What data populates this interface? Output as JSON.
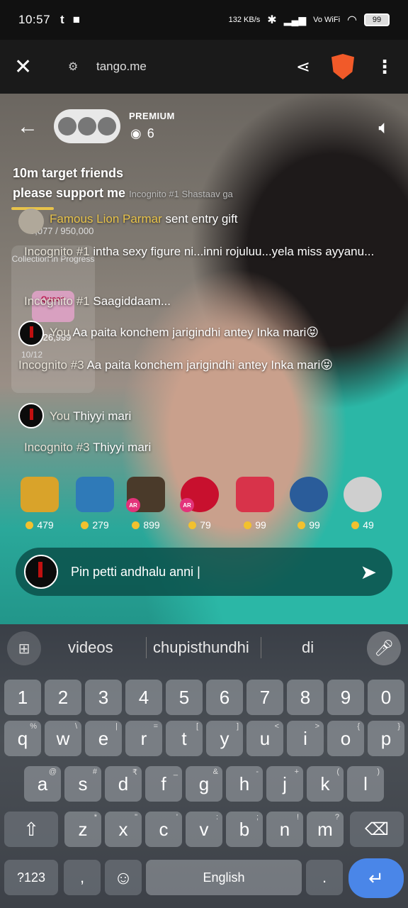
{
  "status_bar": {
    "time": "10:57",
    "net_speed": "132 KB/s",
    "network": "Vo WiFi",
    "battery": "99"
  },
  "browser": {
    "url": "tango.me"
  },
  "stream": {
    "premium_label": "PREMIUM",
    "viewer_count": "6",
    "target_line1": "10m target friends",
    "target_line2": "please support me",
    "overlay_text": "Incognito #1 Shastaav ga",
    "goal_progress": "5,077 / 950,000",
    "collection_title": "Collection in Progress",
    "collection_badge": "Queen",
    "collection_coins": "26,999",
    "collection_progress": "10/12"
  },
  "chat": [
    {
      "name": "Famous Lion Parmar",
      "text": "sent entry gift"
    },
    {
      "name": "Incognito #1",
      "text": "intha sexy figure ni...inni rojuluu...yela miss ayyanu..."
    },
    {
      "name": "Incognito #1",
      "text": "Saagiddaam..."
    },
    {
      "name": "You",
      "text": "Aa paita konchem jarigindhi antey Inka mari😝"
    },
    {
      "name": "Incognito #3",
      "text": "Aa paita konchem jarigindhi antey Inka mari😝"
    },
    {
      "name": "You",
      "text": "Thiyyi mari"
    },
    {
      "name": "Incognito #3",
      "text": "Thiyyi mari"
    }
  ],
  "gifts": [
    {
      "price": "479",
      "color": "#d9a32a"
    },
    {
      "price": "279",
      "color": "#2f7ab8"
    },
    {
      "price": "899",
      "color": "#4a3a2a",
      "ar": "AR"
    },
    {
      "price": "79",
      "color": "#c8102e",
      "ar": "AR"
    },
    {
      "price": "99",
      "color": "#d8334a"
    },
    {
      "price": "99",
      "color": "#2a5c9a"
    },
    {
      "price": "49",
      "color": "#cfcfcf"
    }
  ],
  "input": {
    "value": "Pin petti andhalu anni |"
  },
  "keyboard": {
    "suggestions": [
      "videos",
      "chupisthundhi",
      "di"
    ],
    "row_numbers": [
      "1",
      "2",
      "3",
      "4",
      "5",
      "6",
      "7",
      "8",
      "9",
      "0"
    ],
    "row1": [
      "q",
      "w",
      "e",
      "r",
      "t",
      "y",
      "u",
      "i",
      "o",
      "p"
    ],
    "row1_hints": [
      "%",
      "\\",
      "|",
      "=",
      "[",
      "]",
      "<",
      ">",
      "{",
      "}"
    ],
    "row2": [
      "a",
      "s",
      "d",
      "f",
      "g",
      "h",
      "j",
      "k",
      "l"
    ],
    "row2_hints": [
      "@",
      "#",
      "₹",
      "_",
      "&",
      "-",
      "+",
      "(",
      ")"
    ],
    "row3": [
      "z",
      "x",
      "c",
      "v",
      "b",
      "n",
      "m"
    ],
    "row3_hints": [
      "*",
      "\"",
      "'",
      ":",
      ";",
      "!",
      "?"
    ],
    "symbols_key": "?123",
    "comma_key": ",",
    "space_label": "English",
    "period_key": "."
  }
}
